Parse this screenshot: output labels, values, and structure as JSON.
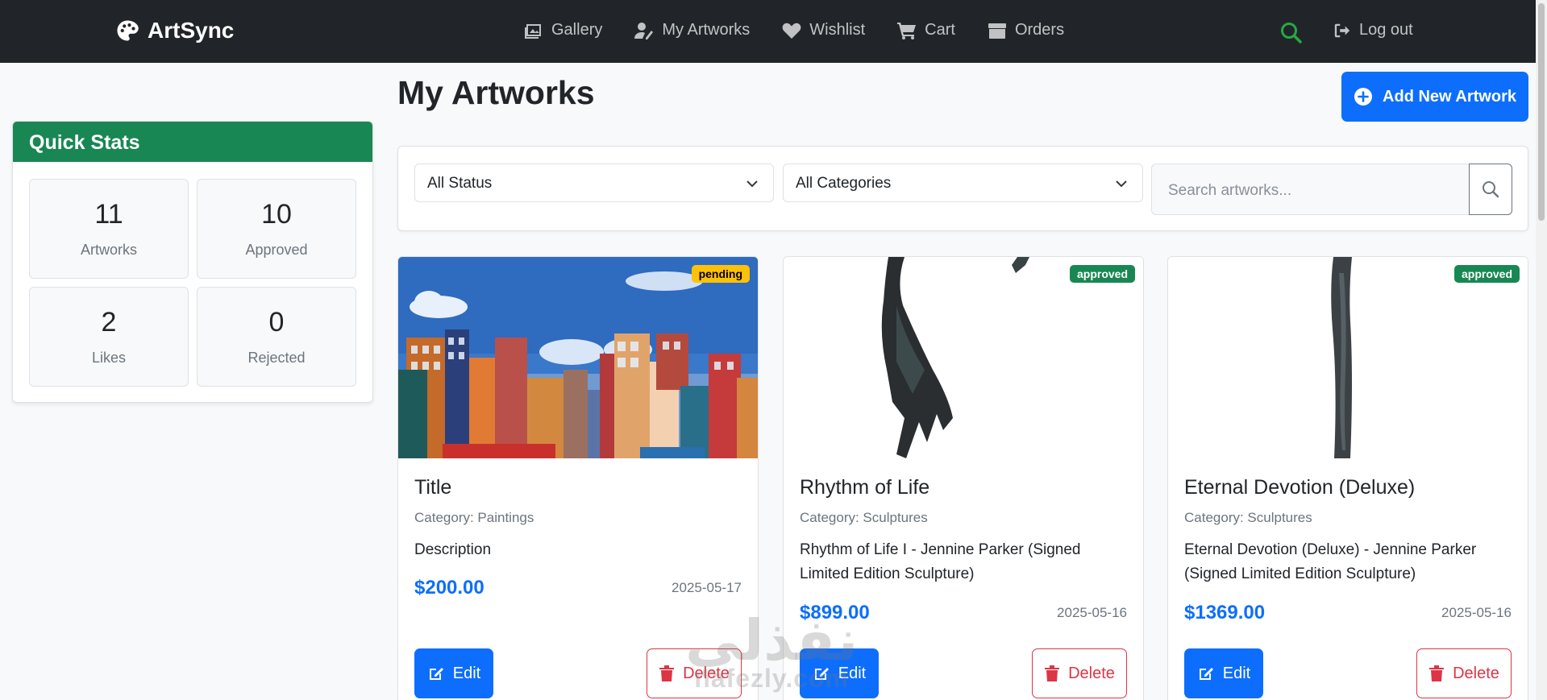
{
  "nav": {
    "brand": "ArtSync",
    "items": [
      {
        "label": "Gallery",
        "icon": "images-icon"
      },
      {
        "label": "My Artworks",
        "icon": "user-paint-icon"
      },
      {
        "label": "Wishlist",
        "icon": "heart-icon"
      },
      {
        "label": "Cart",
        "icon": "cart-icon"
      },
      {
        "label": "Orders",
        "icon": "box-icon"
      }
    ],
    "logout": "Log out",
    "search_color": "#28a745"
  },
  "stats": {
    "title": "Quick Stats",
    "items": [
      {
        "value": "11",
        "label": "Artworks"
      },
      {
        "value": "10",
        "label": "Approved"
      },
      {
        "value": "2",
        "label": "Likes"
      },
      {
        "value": "0",
        "label": "Rejected"
      }
    ]
  },
  "main": {
    "title": "My Artworks",
    "add_button": "Add New Artwork",
    "filters": {
      "status": "All Status",
      "category": "All Categories",
      "search_placeholder": "Search artworks..."
    },
    "artworks": [
      {
        "title": "Title",
        "category": "Category: Paintings",
        "description": "Description",
        "price": "$200.00",
        "date": "2025-05-17",
        "status": "pending"
      },
      {
        "title": "Rhythm of Life",
        "category": "Category: Sculptures",
        "description": "Rhythm of Life I - Jennine Parker (Signed Limited Edition Sculpture)",
        "price": "$899.00",
        "date": "2025-05-16",
        "status": "approved"
      },
      {
        "title": "Eternal Devotion (Deluxe)",
        "category": "Category: Sculptures",
        "description": "Eternal Devotion (Deluxe) - Jennine Parker (Signed Limited Edition Sculpture)",
        "price": "$1369.00",
        "date": "2025-05-16",
        "status": "approved"
      }
    ],
    "edit_label": "Edit",
    "delete_label": "Delete"
  },
  "watermark": {
    "arabic": "نفذلي",
    "latin": "nafezly.com"
  }
}
